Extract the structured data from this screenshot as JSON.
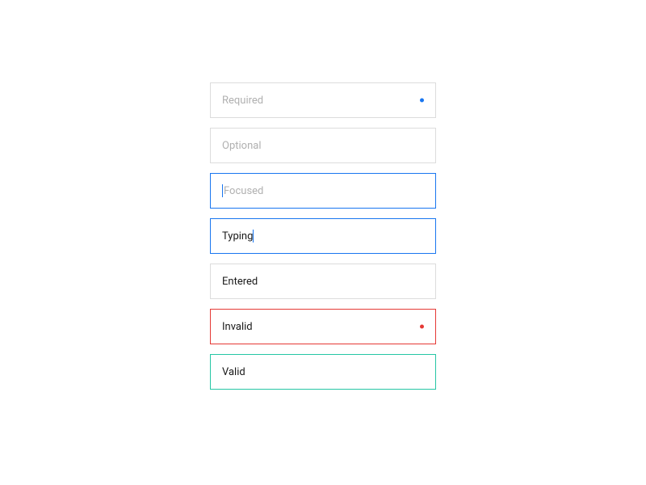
{
  "fields": {
    "required": {
      "placeholder": "Required"
    },
    "optional": {
      "placeholder": "Optional"
    },
    "focused": {
      "placeholder": "Focused"
    },
    "typing": {
      "value": "Typing"
    },
    "entered": {
      "value": "Entered"
    },
    "invalid": {
      "value": "Invalid"
    },
    "valid": {
      "value": "Valid"
    }
  },
  "colors": {
    "border_default": "#dcdcdc",
    "border_focus": "#1976f0",
    "border_invalid": "#e53935",
    "border_valid": "#26c6a5",
    "placeholder": "#b0b0b0",
    "text": "#1a1a1a"
  }
}
